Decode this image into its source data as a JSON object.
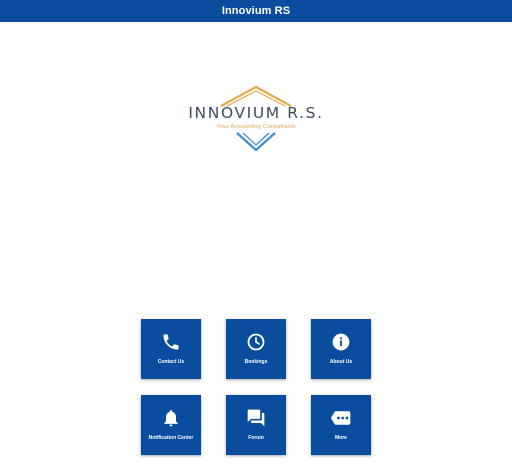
{
  "header": {
    "title": "Innovium RS"
  },
  "logo": {
    "name": "INNOVIUM R.S.",
    "tagline": "Your Accounting Consultants",
    "colors": {
      "gold": "#e3a94a",
      "blue": "#3a8fc9",
      "text": "#3e4c5f"
    }
  },
  "tiles": [
    {
      "label": "Contact Us",
      "icon": "phone-icon"
    },
    {
      "label": "Bookings",
      "icon": "clock-icon"
    },
    {
      "label": "About Us",
      "icon": "info-icon"
    },
    {
      "label": "Notification Center",
      "icon": "bell-icon"
    },
    {
      "label": "Forum",
      "icon": "chat-bubbles-icon"
    },
    {
      "label": "More",
      "icon": "more-icon"
    }
  ],
  "colors": {
    "brand": "#0a4d9f",
    "background": "#ffffff"
  }
}
